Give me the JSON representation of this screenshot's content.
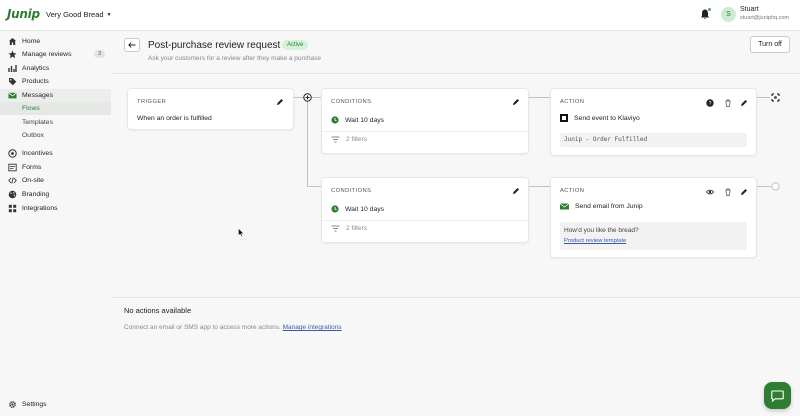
{
  "app": {
    "logo": "Junip",
    "store_name": "Very Good Bread",
    "user_name": "Stuart",
    "user_email": "stuart@juniphq.com",
    "avatar_initial": "S"
  },
  "sidebar": {
    "items": [
      {
        "label": "Home",
        "icon": "home-icon"
      },
      {
        "label": "Manage reviews",
        "icon": "star-icon",
        "count": "3"
      },
      {
        "label": "Analytics",
        "icon": "chart-icon"
      },
      {
        "label": "Products",
        "icon": "tag-icon"
      },
      {
        "label": "Messages",
        "icon": "envelope-icon"
      },
      {
        "label": "Flows"
      },
      {
        "label": "Templates"
      },
      {
        "label": "Outbox"
      },
      {
        "label": "Incentives",
        "icon": "gift-icon"
      },
      {
        "label": "Forms",
        "icon": "form-icon"
      },
      {
        "label": "On-site",
        "icon": "code-icon"
      },
      {
        "label": "Branding",
        "icon": "palette-icon"
      },
      {
        "label": "Integrations",
        "icon": "grid-icon"
      }
    ],
    "settings_label": "Settings"
  },
  "header": {
    "title": "Post-purchase review request",
    "status": "Active",
    "subtitle": "Ask your customers for a review after they make a purchase",
    "turn_off_label": "Turn off"
  },
  "flow": {
    "trigger": {
      "label": "TRIGGER",
      "text": "When an order is fulfilled"
    },
    "conditions_1": {
      "label": "CONDITIONS",
      "wait": "Wait 10 days",
      "filters": "2 filters"
    },
    "action_1": {
      "label": "ACTION",
      "title": "Send event to Klaviyo",
      "event": "Junip - Order Fulfilled"
    },
    "conditions_2": {
      "label": "CONDITIONS",
      "wait": "Wait 10 days",
      "filters": "2 filters"
    },
    "action_2": {
      "label": "ACTION",
      "title": "Send email from Junip",
      "message": "How'd you like the bread?",
      "template_link": "Product review template"
    }
  },
  "footer": {
    "no_actions": "No actions available",
    "connect_text": "Connect an email or SMS app to access more actions.",
    "manage_link": "Manage integrations"
  },
  "colors": {
    "brand": "#2e7d32",
    "active_badge_bg": "#d6f1da",
    "link": "#3a5ba8"
  }
}
